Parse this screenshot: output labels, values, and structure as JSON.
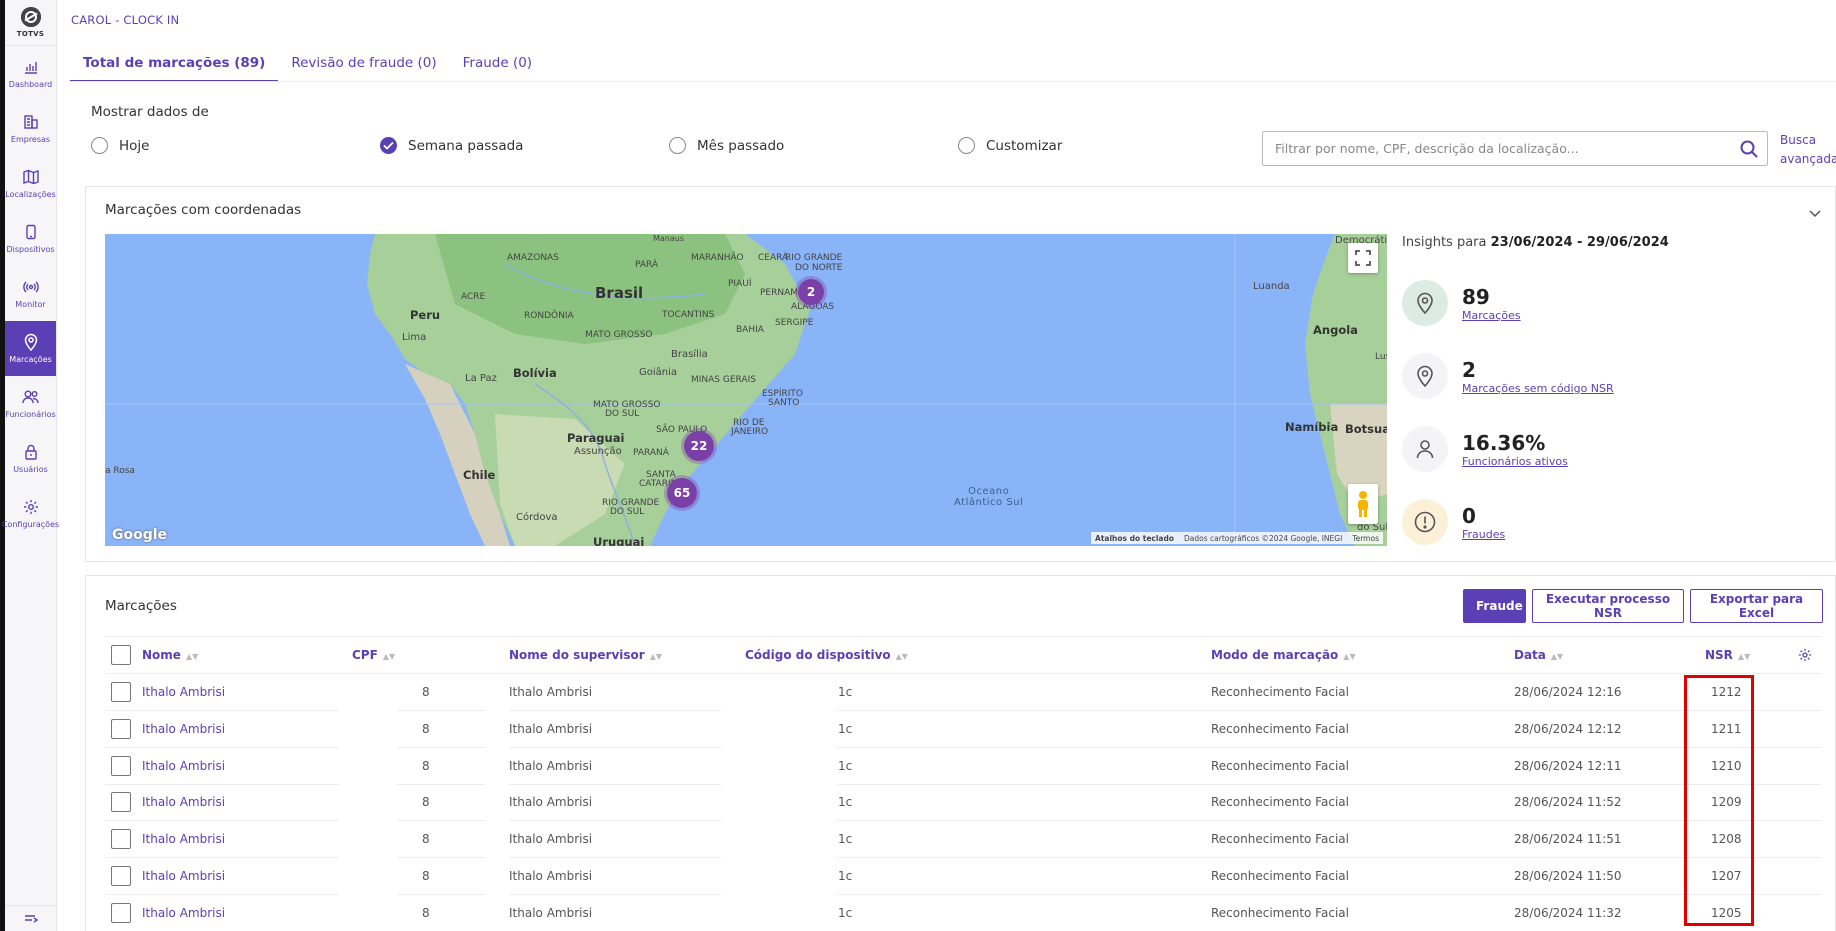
{
  "app": {
    "title": "CAROL - CLOCK IN",
    "brand": "TOTVS"
  },
  "sidebar": {
    "items": [
      {
        "label": "Dashboard",
        "icon": "bar-chart-icon"
      },
      {
        "label": "Empresas",
        "icon": "building-icon"
      },
      {
        "label": "Localizações",
        "icon": "map-icon"
      },
      {
        "label": "Dispositivos",
        "icon": "phone-icon"
      },
      {
        "label": "Monitor",
        "icon": "broadcast-icon"
      },
      {
        "label": "Marcações",
        "icon": "location-pin-icon",
        "active": true
      },
      {
        "label": "Funcionários",
        "icon": "users-icon"
      },
      {
        "label": "Usuários",
        "icon": "lock-icon"
      },
      {
        "label": "Configurações",
        "icon": "gear-icon"
      }
    ]
  },
  "tabs": [
    {
      "label": "Total de marcações (89)",
      "active": true
    },
    {
      "label": "Revisão de fraude (0)"
    },
    {
      "label": "Fraude (0)"
    }
  ],
  "filters": {
    "label": "Mostrar dados de",
    "options": [
      {
        "label": "Hoje",
        "checked": false
      },
      {
        "label": "Semana passada",
        "checked": true
      },
      {
        "label": "Mês passado",
        "checked": false
      },
      {
        "label": "Customizar",
        "checked": false
      }
    ],
    "search_placeholder": "Filtrar por nome, CPF, descrição da localização...",
    "advanced_line1": "Busca",
    "advanced_line2": "avançada"
  },
  "map_panel": {
    "title": "Marcações com coordenadas",
    "clusters": [
      "2",
      "22",
      "65"
    ],
    "labels": {
      "brasil": "Brasil",
      "peru": "Peru",
      "lima": "Lima",
      "bolivia": "Bolívia",
      "lapaz": "La Paz",
      "paraguai": "Paraguai",
      "assuncao": "Assunção",
      "chile": "Chile",
      "cordova": "Córdova",
      "uruguai": "Uruguai",
      "brasilia": "Brasília",
      "goiania": "Goiânia",
      "angola": "Angola",
      "luanda": "Luanda",
      "namibia": "Namíbia",
      "botsuana": "Botsuan",
      "ocean1": "Oceano",
      "ocean2": "Atlântico Sul",
      "amazonas": "AMAZONAS",
      "para": "PARÁ",
      "maranhao": "MARANHÃO",
      "ceara": "CEARÁ",
      "rgn": "RIO GRANDE",
      "norte": "DO NORTE",
      "piaui": "PIAUÍ",
      "pernambuco": "PERNAMBUCO",
      "alagoas": "ALAGOAS",
      "sergipe": "SERGIPE",
      "acre": "ACRE",
      "rondonia": "RONDÔNIA",
      "tocantins": "TOCANTINS",
      "bahia": "BAHIA",
      "matogrosso": "MATO GROSSO",
      "minas": "MINAS GERAIS",
      "es1": "ESPÍRITO",
      "es2": "SANTO",
      "ms1": "MATO GROSSO",
      "ms2": "DO SUL",
      "sp": "SÃO PAULO",
      "rj1": "RIO DE",
      "rj2": "JANEIRO",
      "parana": "PARANÁ",
      "sc1": "SANTA",
      "sc2": "CATARINA",
      "rs1": "RIO GRANDE",
      "rs2": "DO SUL",
      "rosa": "a Rosa",
      "congo": "Democráti",
      "manaus": "Manaus",
      "lus": "Lus",
      "dosul": "do Sul",
      "ca": "ca"
    },
    "google": "Google",
    "attribution": {
      "shortcuts": "Atalhos do teclado",
      "data": "Dados cartográficos ©2024 Google, INEGI",
      "terms": "Termos"
    }
  },
  "insights": {
    "title_prefix": "Insights para",
    "period": "23/06/2024 - 29/06/2024",
    "items": [
      {
        "value": "89",
        "label": "Marcações",
        "icon": "location-pin-icon"
      },
      {
        "value": "2",
        "label": "Marcações sem código NSR",
        "icon": "location-pin-icon"
      },
      {
        "value": "16.36%",
        "label": "Funcionários ativos",
        "icon": "person-icon"
      },
      {
        "value": "0",
        "label": "Fraudes",
        "icon": "alert-icon"
      }
    ]
  },
  "table": {
    "title": "Marcações",
    "buttons": {
      "fraud": "Fraude",
      "nsr": "Executar processo NSR",
      "export": "Exportar para Excel"
    },
    "columns": [
      "Nome",
      "CPF",
      "Nome do supervisor",
      "Código do dispositivo",
      "Modo de marcação",
      "Data",
      "NSR"
    ],
    "rows": [
      {
        "name": "Ithalo Ambrisi",
        "cpf": "8",
        "supervisor": "Ithalo Ambrisi",
        "device": "1c",
        "mode": "Reconhecimento Facial",
        "date": "28/06/2024 12:16",
        "nsr": "1212"
      },
      {
        "name": "Ithalo Ambrisi",
        "cpf": "8",
        "supervisor": "Ithalo Ambrisi",
        "device": "1c",
        "mode": "Reconhecimento Facial",
        "date": "28/06/2024 12:12",
        "nsr": "1211"
      },
      {
        "name": "Ithalo Ambrisi",
        "cpf": "8",
        "supervisor": "Ithalo Ambrisi",
        "device": "1c",
        "mode": "Reconhecimento Facial",
        "date": "28/06/2024 12:11",
        "nsr": "1210"
      },
      {
        "name": "Ithalo Ambrisi",
        "cpf": "8",
        "supervisor": "Ithalo Ambrisi",
        "device": "1c",
        "mode": "Reconhecimento Facial",
        "date": "28/06/2024 11:52",
        "nsr": "1209"
      },
      {
        "name": "Ithalo Ambrisi",
        "cpf": "8",
        "supervisor": "Ithalo Ambrisi",
        "device": "1c",
        "mode": "Reconhecimento Facial",
        "date": "28/06/2024 11:51",
        "nsr": "1208"
      },
      {
        "name": "Ithalo Ambrisi",
        "cpf": "8",
        "supervisor": "Ithalo Ambrisi",
        "device": "1c",
        "mode": "Reconhecimento Facial",
        "date": "28/06/2024 11:50",
        "nsr": "1207"
      },
      {
        "name": "Ithalo Ambrisi",
        "cpf": "8",
        "supervisor": "Ithalo Ambrisi",
        "device": "1c",
        "mode": "Reconhecimento Facial",
        "date": "28/06/2024 11:32",
        "nsr": "1205"
      }
    ]
  },
  "colors": {
    "accent": "#5b3fb5",
    "cluster": "#7b3fa8",
    "highlight": "#e00000"
  }
}
